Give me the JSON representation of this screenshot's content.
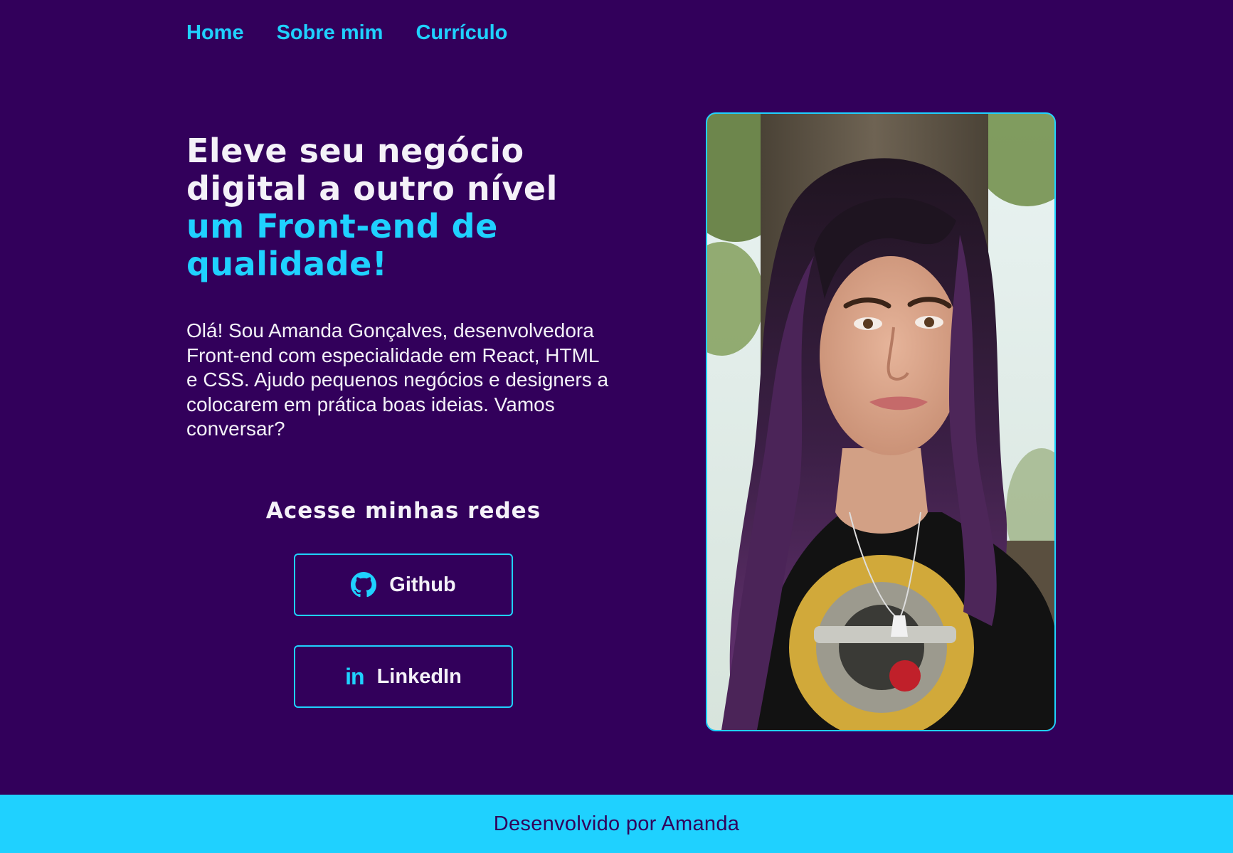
{
  "nav": {
    "items": [
      {
        "label": "Home"
      },
      {
        "label": "Sobre mim"
      },
      {
        "label": "Currículo"
      }
    ]
  },
  "hero": {
    "title_line1": "Eleve seu negócio digital a outro nível",
    "title_line2": "um Front-end de qualidade!",
    "intro": "Olá! Sou Amanda Gonçalves, desenvolvedora Front-end com especialidade em React, HTML e CSS. Ajudo pequenos negócios e designers a colocarem em prática boas ideias. Vamos conversar?"
  },
  "social": {
    "heading": "Acesse minhas redes",
    "github_label": "Github",
    "github_icon": "github-icon",
    "linkedin_label": "LinkedIn",
    "linkedin_icon": "linkedin-icon",
    "linkedin_glyph": "in"
  },
  "footer": {
    "text": "Desenvolvido por Amanda"
  },
  "colors": {
    "background": "#32005b",
    "accent": "#1fd1ff",
    "text": "#f4f1f8"
  }
}
